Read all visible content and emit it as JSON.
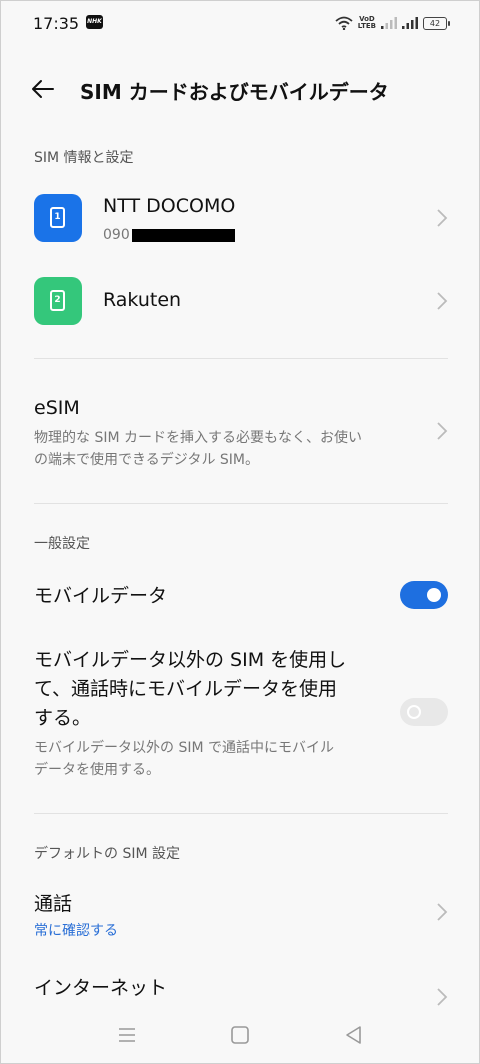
{
  "status_bar": {
    "time": "17:35",
    "nhk_label": "NHK",
    "volte_top": "VoD",
    "volte_bottom": "LTEB",
    "battery": "42"
  },
  "header": {
    "title": "SIM カードおよびモバイルデータ"
  },
  "sim_info": {
    "section_label": "SIM 情報と設定",
    "sims": [
      {
        "slot": "1",
        "name": "NTT DOCOMO",
        "number_prefix": "090",
        "color": "#1a73e8"
      },
      {
        "slot": "2",
        "name": "Rakuten",
        "color": "#34c77b"
      }
    ]
  },
  "esim": {
    "title": "eSIM",
    "description_line1": "物理的な SIM カードを挿入する必要もなく、お使い",
    "description_line2": "の端末で使用できるデジタル SIM。"
  },
  "general": {
    "section_label": "一般設定",
    "mobile_data_label": "モバイルデータ",
    "mobile_data_enabled": true,
    "call_data_title_line1": "モバイルデータ以外の SIM を使用し",
    "call_data_title_line2": "て、通話時にモバイルデータを使用",
    "call_data_title_line3": "する。",
    "call_data_desc_line1": "モバイルデータ以外の SIM で通話中にモバイル",
    "call_data_desc_line2": "データを使用する。",
    "call_data_enabled": false
  },
  "default_sim": {
    "section_label": "デフォルトの SIM 設定",
    "call_label": "通話",
    "call_value": "常に確認する",
    "internet_label": "インターネット"
  },
  "colors": {
    "accent": "#1e6fe0",
    "link": "#2a6fd6"
  }
}
